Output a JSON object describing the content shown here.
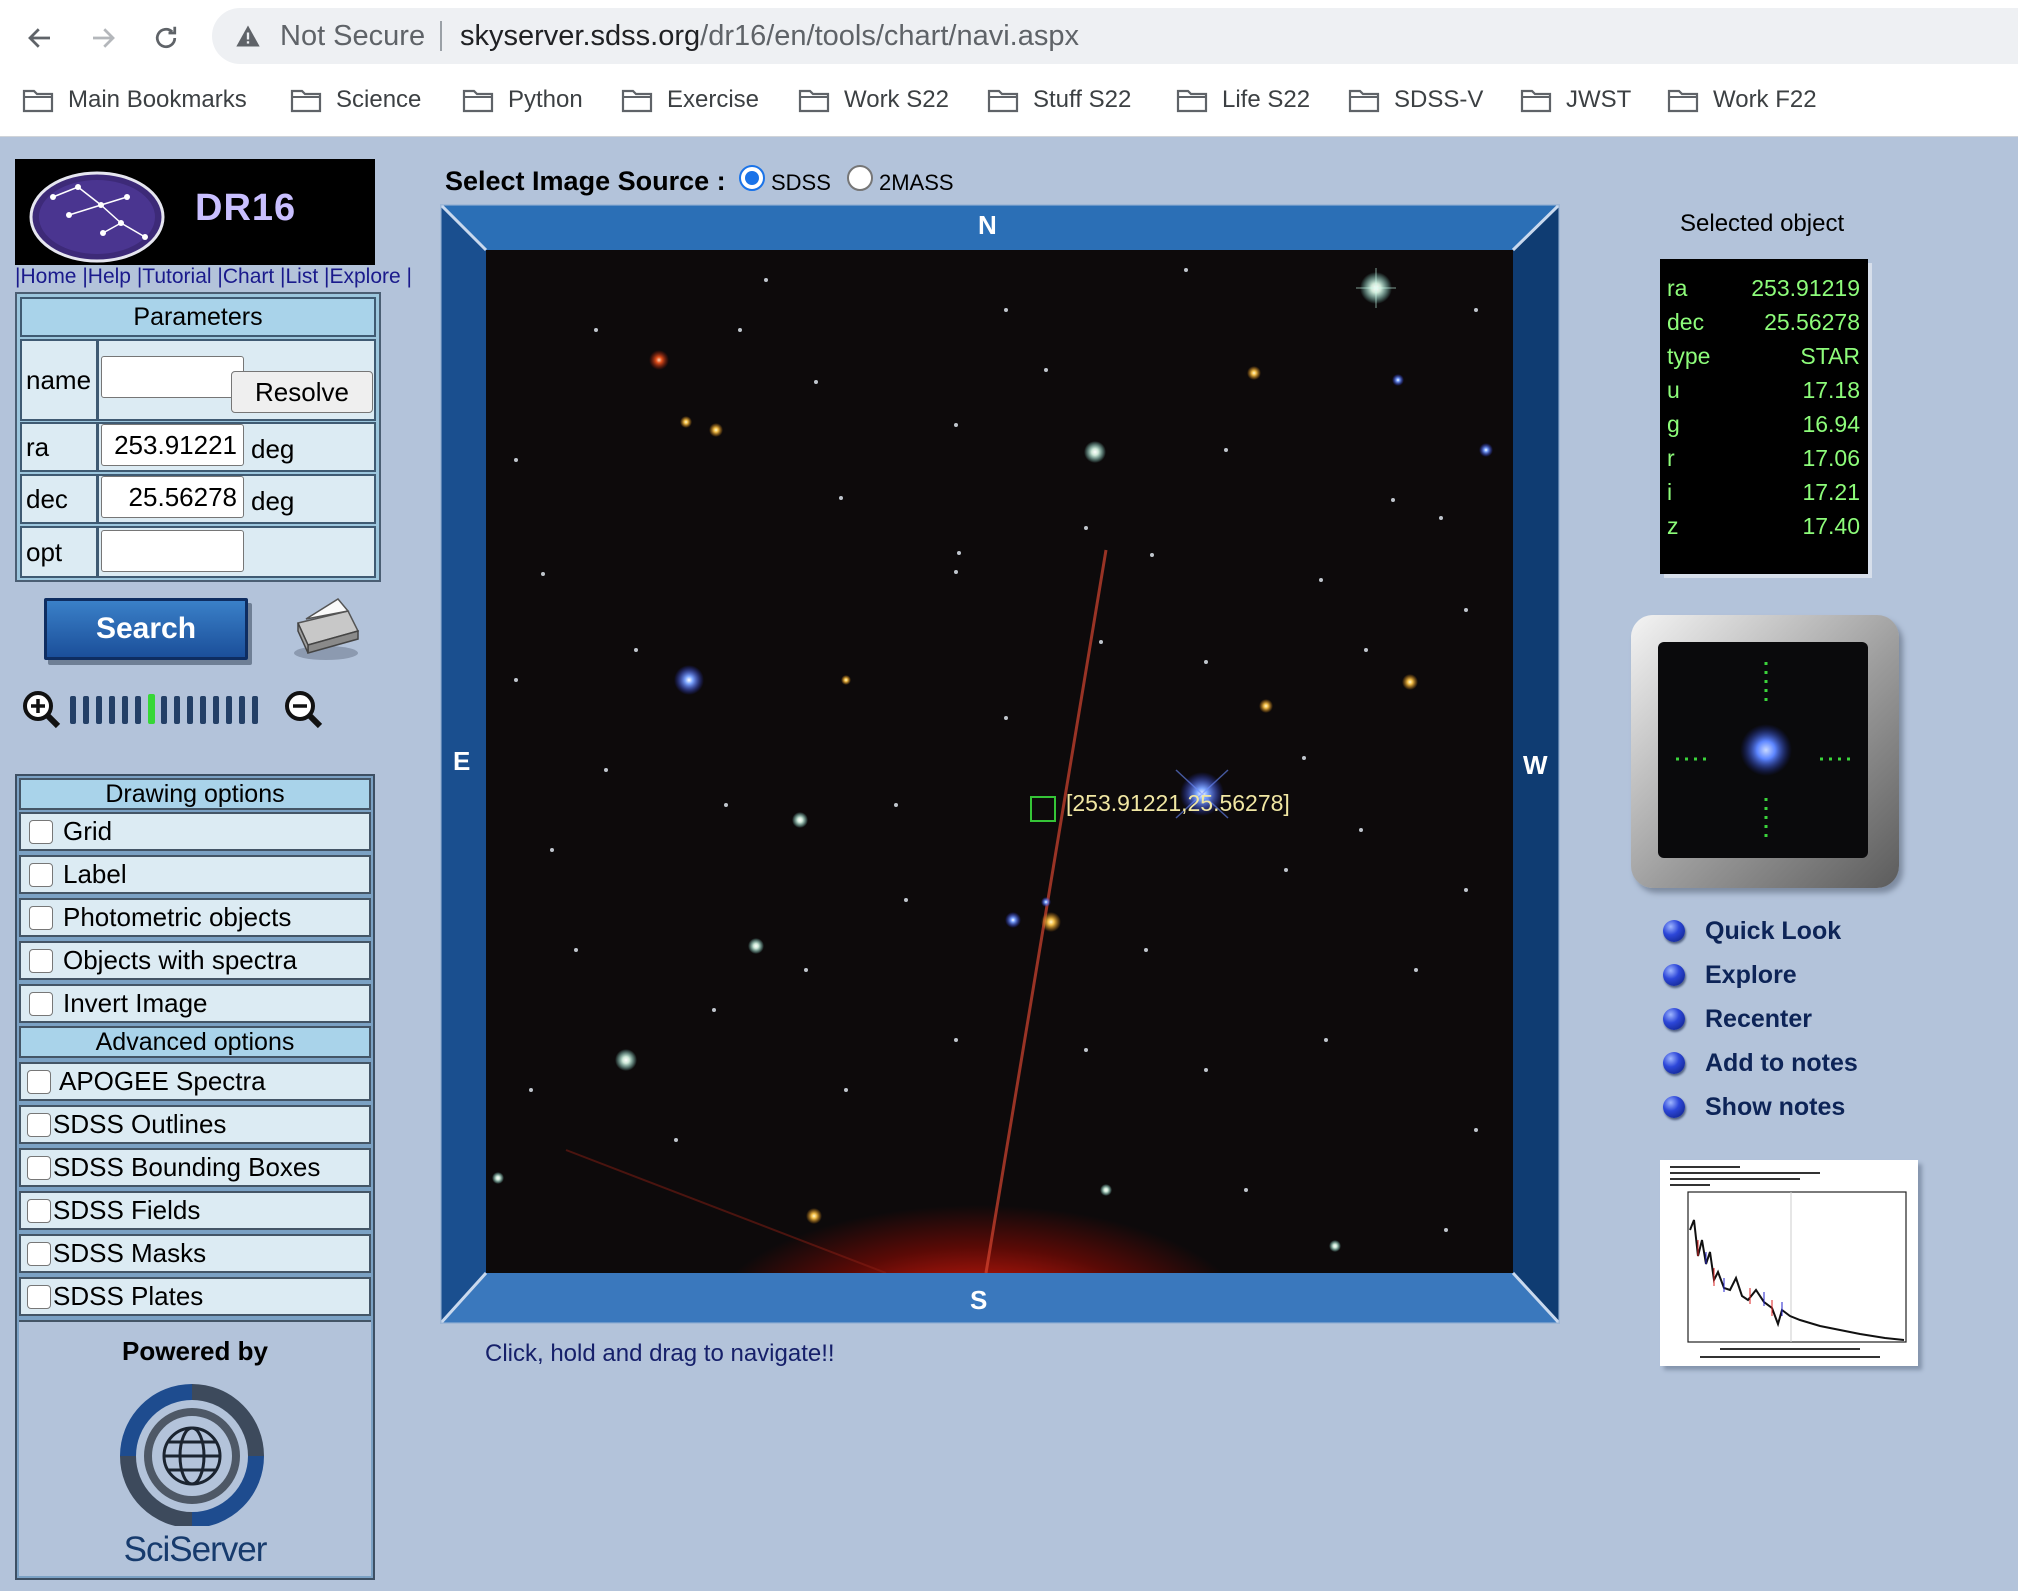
{
  "browser": {
    "security_label": "Not Secure",
    "url_host": "skyserver.sdss.org",
    "url_path": "/dr16/en/tools/chart/navi.aspx",
    "bookmarks": [
      "Main Bookmarks",
      "Science",
      "Python",
      "Exercise",
      "Work S22",
      "Stuff S22",
      "Life S22",
      "SDSS-V",
      "JWST",
      "Work F22"
    ]
  },
  "logo": {
    "title": "DR16"
  },
  "top_links": [
    "Home",
    "Help",
    "Tutorial",
    "Chart",
    "List",
    "Explore"
  ],
  "parameters": {
    "header": "Parameters",
    "name_label": "name",
    "name_value": "",
    "resolve_label": "Resolve",
    "ra_label": "ra",
    "ra_value": "253.91221",
    "ra_unit": "deg",
    "dec_label": "dec",
    "dec_value": "25.56278",
    "dec_unit": "deg",
    "opt_label": "opt",
    "opt_value": ""
  },
  "search_label": "Search",
  "drawing_options": {
    "header": "Drawing options",
    "items": [
      "Grid",
      "Label",
      "Photometric objects",
      "Objects with spectra",
      "Invert Image"
    ]
  },
  "advanced_options": {
    "header": "Advanced options",
    "items": [
      "APOGEE Spectra",
      "SDSS Outlines",
      "SDSS Bounding Boxes",
      "SDSS Fields",
      "SDSS Masks",
      "SDSS Plates"
    ]
  },
  "powered_by": {
    "label": "Powered by",
    "name": "SciServer"
  },
  "image_source": {
    "label": "Select Image Source :",
    "options": [
      "SDSS",
      "2MASS"
    ],
    "selected": "SDSS"
  },
  "viewer": {
    "north": "N",
    "south": "S",
    "east": "E",
    "west": "W",
    "marker_label": "[253.91221,25.56278]",
    "hint": "Click, hold and drag to navigate!!"
  },
  "selected_object": {
    "title": "Selected object",
    "fields": [
      {
        "key": "ra",
        "value": "253.91219"
      },
      {
        "key": "dec",
        "value": "25.56278"
      },
      {
        "key": "type",
        "value": "STAR"
      },
      {
        "key": "u",
        "value": "17.18"
      },
      {
        "key": "g",
        "value": "16.94"
      },
      {
        "key": "r",
        "value": "17.06"
      },
      {
        "key": "i",
        "value": "17.21"
      },
      {
        "key": "z",
        "value": "17.40"
      }
    ]
  },
  "actions": [
    "Quick Look",
    "Explore",
    "Recenter",
    "Add to notes",
    "Show notes"
  ],
  "colors": {
    "page_bg": "#b3c3da",
    "frame_blue": "#1d4f8c",
    "panel_text_green": "#8dfc7a",
    "marker_green": "#35c437"
  }
}
